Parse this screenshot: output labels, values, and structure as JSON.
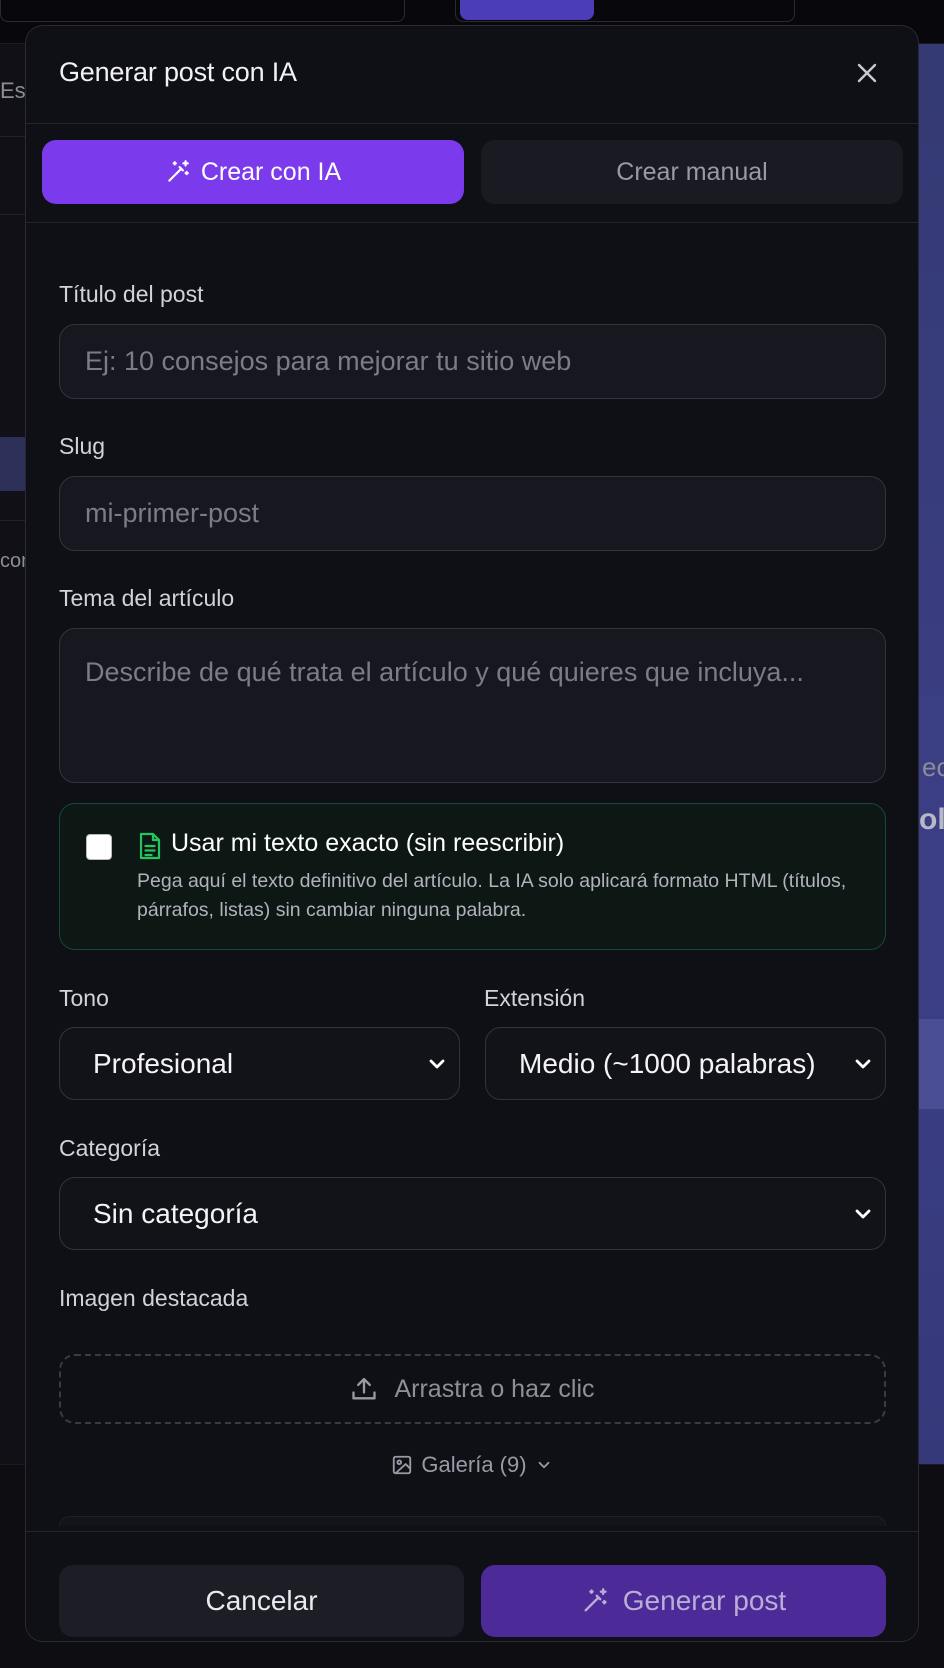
{
  "background": {
    "fragments": [
      "Est",
      "con",
      "ec",
      "olo"
    ]
  },
  "modal": {
    "title": "Generar post con IA",
    "close_icon": "close-icon"
  },
  "tabs": {
    "ai_label": "Crear con IA",
    "manual_label": "Crear manual",
    "active": "ai"
  },
  "form": {
    "title_label": "Título del post",
    "title_placeholder": "Ej: 10 consejos para mejorar tu sitio web",
    "slug_label": "Slug",
    "slug_placeholder": "mi-primer-post",
    "topic_label": "Tema del artículo",
    "topic_placeholder": "Describe de qué trata el artículo y qué quieres que incluya...",
    "exact_text": {
      "title": "Usar mi texto exacto (sin reescribir)",
      "description": "Pega aquí el texto definitivo del artículo. La IA solo aplicará formato HTML (títulos, párrafos, listas) sin cambiar ninguna palabra.",
      "checked": false
    },
    "tone_label": "Tono",
    "tone_value": "Profesional",
    "length_label": "Extensión",
    "length_value": "Medio (~1000 palabras)",
    "category_label": "Categoría",
    "category_value": "Sin categoría",
    "image_label": "Imagen destacada",
    "upload_label": "Arrastra o haz clic",
    "gallery_label": "Galería (9)"
  },
  "footer": {
    "cancel_label": "Cancelar",
    "generate_label": "Generar post"
  },
  "colors": {
    "accent": "#7c3aed",
    "generate_disabled": "#4c2a97",
    "success_icon": "#22c55e"
  }
}
